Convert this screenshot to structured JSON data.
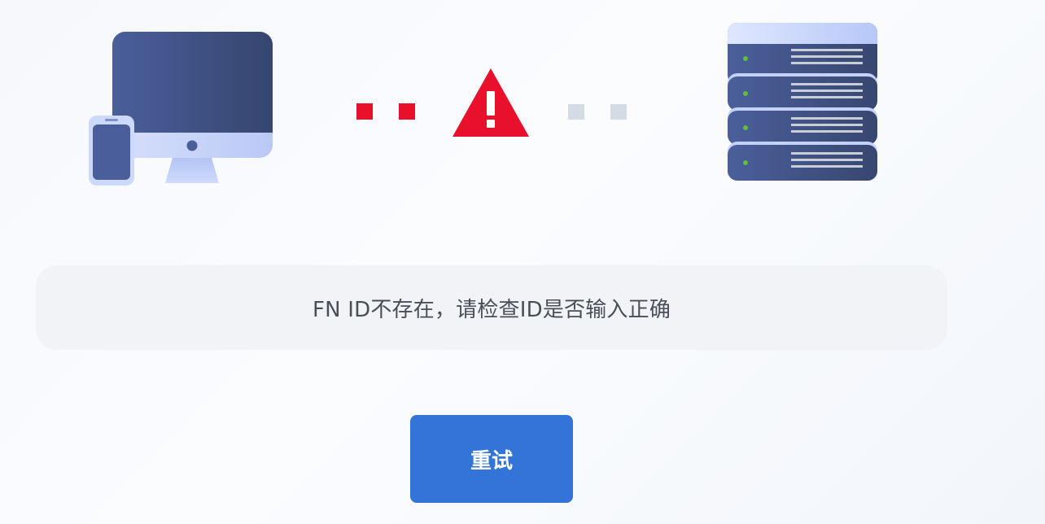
{
  "illustration": {
    "client_icon": "desktop-and-phone-icon",
    "server_icon": "server-rack-icon",
    "warning_icon": "warning-triangle-icon",
    "colors": {
      "error_red": "#e8102a",
      "inactive_gray": "#d3dbe5",
      "device_dark": "#3e4f82",
      "device_light": "#c3d1fb",
      "server_led": "#5fbf3a"
    }
  },
  "message": {
    "text": "FN ID不存在，请检查ID是否输入正确"
  },
  "retry_button": {
    "label": "重试",
    "color": "#3374d9"
  }
}
